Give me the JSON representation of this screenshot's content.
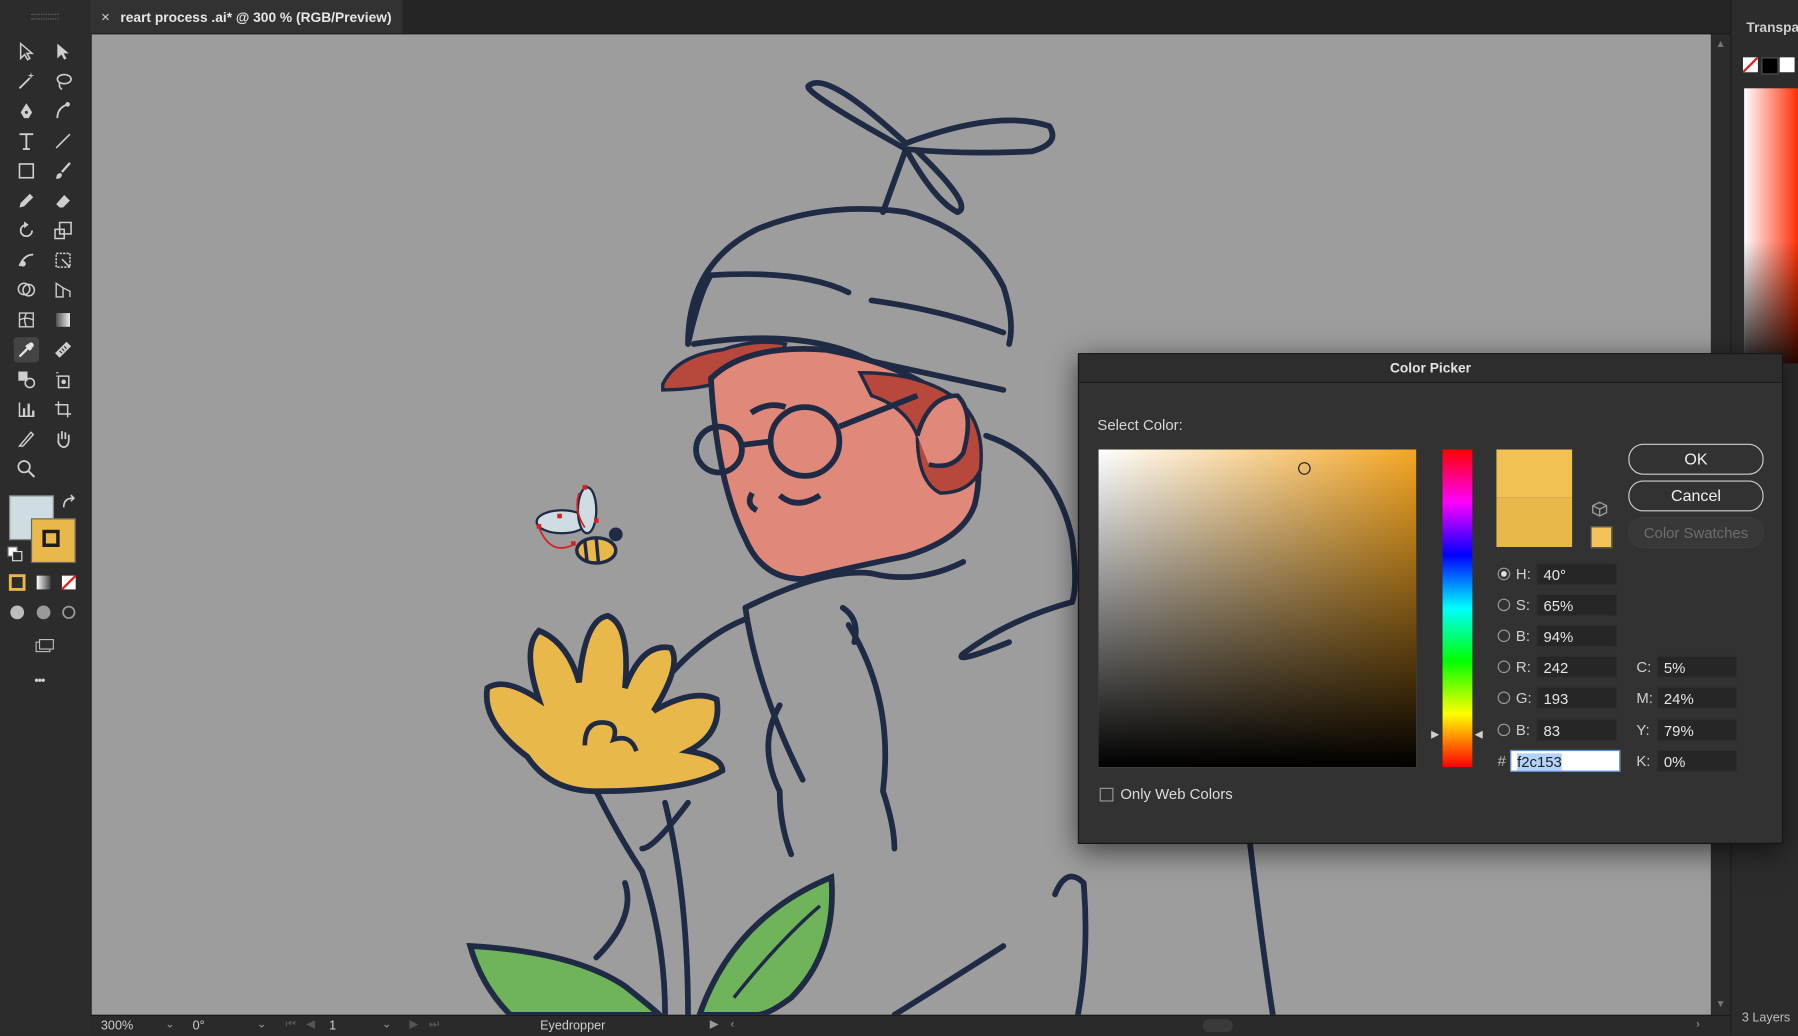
{
  "document_tab": {
    "close": "×",
    "title": "reart process .ai* @ 300 % (RGB/Preview)"
  },
  "status_bar": {
    "zoom": "300%",
    "rotation": "0°",
    "artboard": "1",
    "current_tool": "Eyedropper"
  },
  "right_panel": {
    "title": "Transpa",
    "layers_count": "3 Layers"
  },
  "toolbar": {
    "more": "•••",
    "fill_color": "#cfdde2",
    "stroke_color": "#e9b84a"
  },
  "color_picker": {
    "title": "Color Picker",
    "select_label": "Select Color:",
    "ok_label": "OK",
    "cancel_label": "Cancel",
    "swatches_label": "Color Swatches",
    "selected_color": "#f2c153",
    "hsb": {
      "h_label": "H:",
      "h": "40°",
      "s_label": "S:",
      "s": "65%",
      "b_label": "B:",
      "b": "94%"
    },
    "rgb": {
      "r_label": "R:",
      "r": "242",
      "g_label": "G:",
      "g": "193",
      "b_label": "B:",
      "b": "83"
    },
    "cmyk": {
      "c_label": "C:",
      "c": "5%",
      "m_label": "M:",
      "m": "24%",
      "y_label": "Y:",
      "y": "79%",
      "k_label": "K:",
      "k": "0%"
    },
    "hex_prefix": "#",
    "hex": "f2c153",
    "web_colors_label": "Only Web Colors"
  }
}
